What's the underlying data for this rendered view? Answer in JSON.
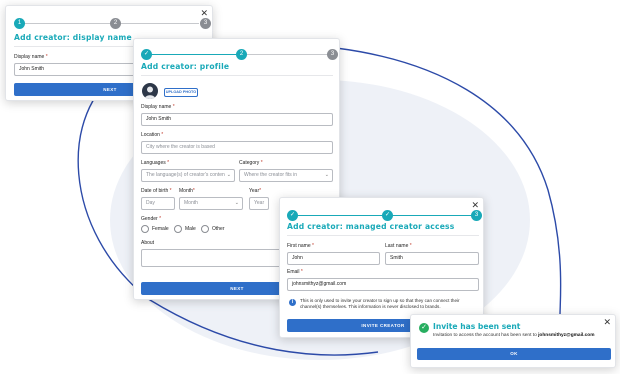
{
  "colors": {
    "teal": "#19a9b8",
    "blue": "#2f6fc9",
    "gray_step": "#8a8d93",
    "success": "#27ae60",
    "required": "#c0392b"
  },
  "card1": {
    "steps": [
      "1",
      "2",
      "3"
    ],
    "title": "Add creator: display name",
    "display_name_label": "Display name",
    "display_name_value": "John Smith",
    "next_label": "NEXT",
    "close_icon": "close-icon"
  },
  "card2": {
    "steps": [
      "✓",
      "2",
      "3"
    ],
    "title": "Add creator: profile",
    "upload_label": "UPLOAD PHOTO",
    "display_name_label": "Display name",
    "display_name_value": "John Smith",
    "location_label": "Location",
    "location_placeholder": "City where the creator is based",
    "languages_label": "Languages",
    "languages_placeholder": "The language(s) of creator's conten",
    "category_label": "Category",
    "category_placeholder": "Where the creator fits in",
    "dob_label": "Date of birth",
    "month_label": "Month",
    "year_label": "Year",
    "day_placeholder": "Day",
    "month_placeholder": "Month",
    "year_placeholder": "Year",
    "gender_label": "Gender",
    "gender_options": [
      "Female",
      "Male",
      "Other"
    ],
    "about_label": "About",
    "next_label": "NEXT",
    "close_icon": "close-icon"
  },
  "card3": {
    "steps": [
      "✓",
      "✓",
      "3"
    ],
    "title": "Add creator: managed creator access",
    "first_name_label": "First name",
    "first_name_value": "John",
    "last_name_label": "Last name",
    "last_name_value": "Smith",
    "email_label": "Email",
    "email_value": "johnsmithyz@gmail.com",
    "info_line1": "This is only used to invite your creator to sign up so that they can connect their",
    "info_line2": "channel(s) themselves. This information is never disclosed to brands.",
    "invite_label": "INVITE CREATOR",
    "close_icon": "close-icon"
  },
  "toast": {
    "title": "Invite has been sent",
    "text_prefix": "Invitation to access the account has been sent to",
    "email": "johnsmithyz@gmail.com",
    "ok_label": "OK",
    "close_icon": "close-icon"
  },
  "required_mark": "*"
}
